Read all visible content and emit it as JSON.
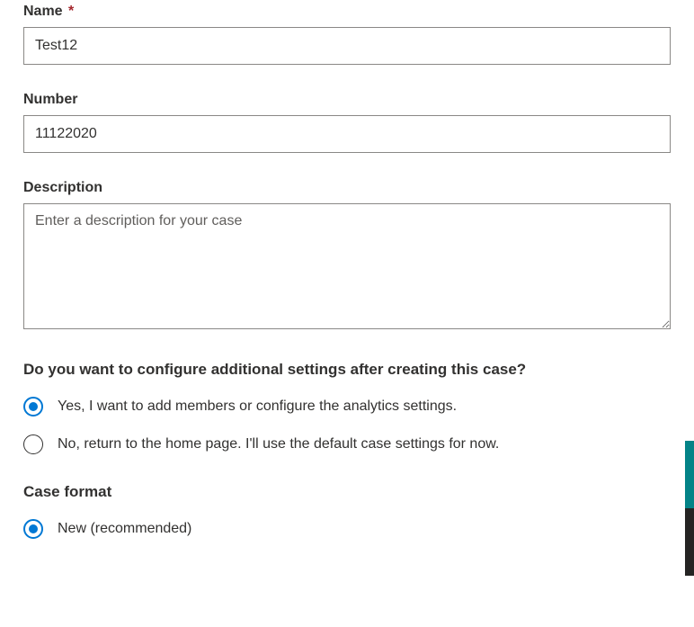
{
  "form": {
    "name": {
      "label": "Name",
      "required_mark": "*",
      "value": "Test12"
    },
    "number": {
      "label": "Number",
      "value": "11122020"
    },
    "description": {
      "label": "Description",
      "placeholder": "Enter a description for your case",
      "value": ""
    },
    "additional_settings": {
      "heading": "Do you want to configure additional settings after creating this case?",
      "options": {
        "yes": "Yes, I want to add members or configure the analytics settings.",
        "no": "No, return to the home page. I'll use the default case settings for now."
      },
      "selected": "yes"
    },
    "case_format": {
      "heading": "Case format",
      "options": {
        "new": "New (recommended)"
      },
      "selected": "new"
    }
  }
}
